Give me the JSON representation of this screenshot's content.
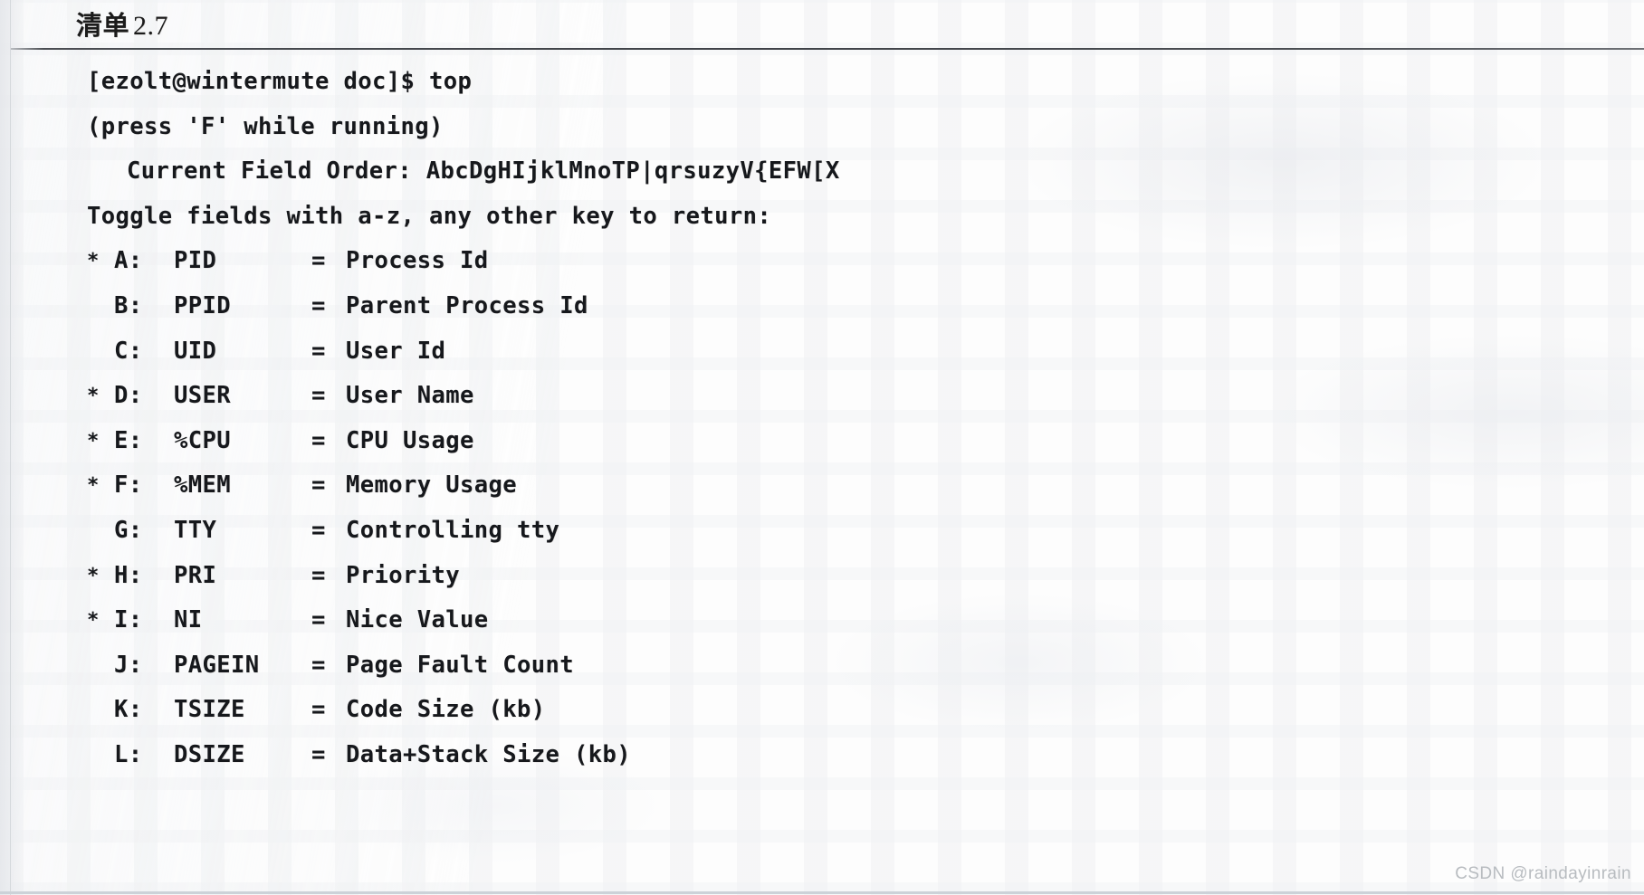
{
  "document": {
    "caption_label": "清单",
    "caption_number": "2.7",
    "watermark": "CSDN @raindayinrain"
  },
  "terminal": {
    "prompt_line": "[ezolt@wintermute doc]$ top",
    "hint_line": "(press 'F' while running)",
    "field_order_line": "Current Field Order: AbcDgHIjklMnoTP|qrsuzyV{EFW[X",
    "toggle_line": "Toggle fields with a-z, any other key to return:",
    "star_glyph": "*",
    "equals_glyph": "=",
    "fields": [
      {
        "star": "*",
        "key": "A:",
        "name": "PID",
        "desc": "Process Id"
      },
      {
        "star": "",
        "key": "B:",
        "name": "PPID",
        "desc": "Parent Process Id"
      },
      {
        "star": "",
        "key": "C:",
        "name": "UID",
        "desc": "User Id"
      },
      {
        "star": "*",
        "key": "D:",
        "name": "USER",
        "desc": "User Name"
      },
      {
        "star": "*",
        "key": "E:",
        "name": "%CPU",
        "desc": "CPU Usage"
      },
      {
        "star": "*",
        "key": "F:",
        "name": "%MEM",
        "desc": "Memory Usage"
      },
      {
        "star": "",
        "key": "G:",
        "name": "TTY",
        "desc": "Controlling tty"
      },
      {
        "star": "*",
        "key": "H:",
        "name": "PRI",
        "desc": "Priority"
      },
      {
        "star": "*",
        "key": "I:",
        "name": "NI",
        "desc": "Nice Value"
      },
      {
        "star": "",
        "key": "J:",
        "name": "PAGEIN",
        "desc": "Page Fault Count"
      },
      {
        "star": "",
        "key": "K:",
        "name": "TSIZE",
        "desc": "Code Size (kb)"
      },
      {
        "star": "",
        "key": "L:",
        "name": "DSIZE",
        "desc": "Data+Stack Size (kb)"
      }
    ]
  },
  "colors": {
    "ink": "#16181c",
    "rule": "#3f4247",
    "watermark": "#b8bcc0",
    "bottom_rule": "#ccd2d8"
  }
}
